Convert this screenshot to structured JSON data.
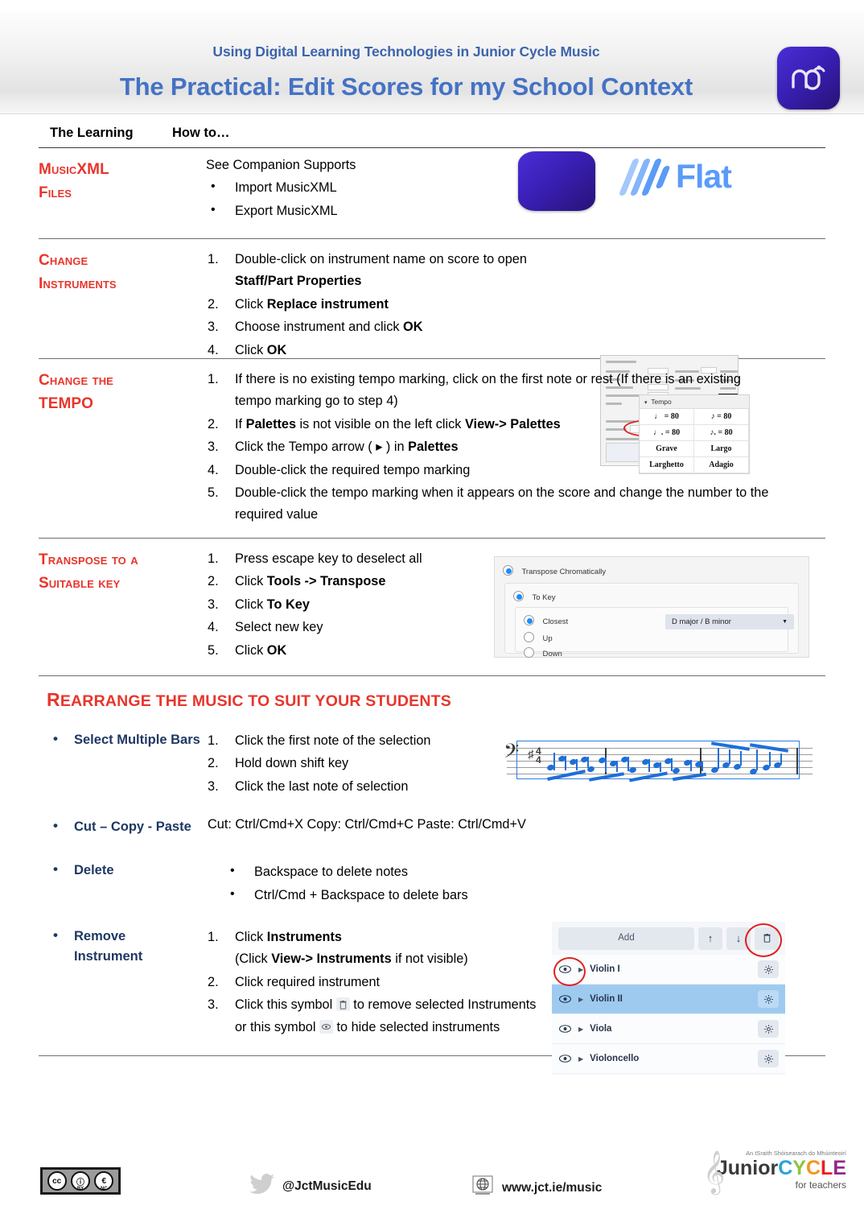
{
  "header": {
    "subtitle": "Using Digital Learning Technologies in Junior Cycle Music",
    "title": "The Practical: Edit Scores for my School Context",
    "logo_icon": "musescore-logo-icon",
    "title_color": "#4472C4",
    "subtitle_color": "#3C64AD"
  },
  "table": {
    "col1_header": "The Learning",
    "col2_header": "How to…",
    "rows": [
      {
        "learning": "MusicXML Files",
        "intro": "See Companion Supports",
        "bullets": [
          "Import MusicXML",
          "Export MusicXML"
        ],
        "figure": "musescore-and-flat-logos",
        "flat_label": "Flat"
      },
      {
        "learning": "Change Instruments",
        "steps": [
          {
            "pre": "Double-click on instrument name on score to open ",
            "bold": "Staff/Part Properties",
            "post": ""
          },
          {
            "pre": "Click ",
            "bold": "Replace instrument",
            "post": ""
          },
          {
            "pre": "Choose instrument and click ",
            "bold": "OK",
            "post": ""
          },
          {
            "pre": "Click ",
            "bold": "OK",
            "post": ""
          }
        ],
        "figure": "staff-part-properties-dialog-screenshot"
      },
      {
        "learning": "Change the Tempo",
        "steps": [
          {
            "pre": "If there is no existing tempo marking, click on the first note or rest (If there is an existing tempo marking go to step 4)",
            "bold": "",
            "post": ""
          },
          {
            "pre": "If ",
            "bold": "Palettes",
            "post": " is not visible on the left click ",
            "bold2": "View-> Palettes"
          },
          {
            "pre": "Click the Tempo arrow ( ▸ ) in ",
            "bold": "Palettes",
            "post": ""
          },
          {
            "pre": "Double-click the required tempo marking",
            "bold": "",
            "post": ""
          },
          {
            "pre": "Double-click the tempo marking when it appears on the score and change the number to the required value",
            "bold": "",
            "post": ""
          }
        ],
        "figure": "tempo-palette-screenshot",
        "palette": {
          "title": "Tempo",
          "cells": [
            "♩ = 80",
            "♪ = 80",
            "♩. = 80",
            "♪. = 80",
            "Grave",
            "Largo",
            "Larghetto",
            "Adagio"
          ]
        }
      },
      {
        "learning": "Transpose to a suitable key",
        "steps": [
          {
            "pre": "Press escape key to deselect all",
            "bold": "",
            "post": ""
          },
          {
            "pre": "Click ",
            "bold": "Tools -> Transpose",
            "post": ""
          },
          {
            "pre": "Click ",
            "bold": "To Key",
            "post": ""
          },
          {
            "pre": "Select new key",
            "bold": "",
            "post": ""
          },
          {
            "pre": "Click ",
            "bold": "OK",
            "post": ""
          }
        ],
        "figure": "transpose-dialog-screenshot",
        "dialog": {
          "opt_chromatic": "Transpose Chromatically",
          "opt_tokey": "To Key",
          "opt_closest": "Closest",
          "opt_up": "Up",
          "opt_down": "Down",
          "key_value": "D major / B minor"
        }
      }
    ]
  },
  "rearrange": {
    "heading": "Rearrange the music to suit your students",
    "items": [
      {
        "label": "Select Multiple Bars",
        "steps": [
          "Click the first note of the selection",
          "Hold down shift key",
          "Click the last note of selection"
        ],
        "figure": "music-staff-selection-screenshot"
      },
      {
        "label": "Cut – Copy - Paste",
        "text": "Cut: Ctrl/Cmd+X   Copy: Ctrl/Cmd+C  Paste: Ctrl/Cmd+V"
      },
      {
        "label": "Delete",
        "bullets": [
          "Backspace to delete notes",
          "Ctrl/Cmd + Backspace to delete bars"
        ]
      },
      {
        "label": "Remove Instrument",
        "steps_rich": [
          {
            "a": "Click ",
            "b": "Instruments",
            "c": "",
            "line2_a": "(Click ",
            "line2_b": "View-> Instruments",
            "line2_c": " if not visible)"
          },
          {
            "a": "Click required instrument",
            "b": "",
            "c": ""
          },
          {
            "a": "Click this symbol ",
            "b": "",
            "c": " to remove selected Instruments or this symbol ",
            "d": " to hide selected instruments",
            "icon1": "trash-icon",
            "icon2": "eye-icon"
          }
        ],
        "figure": "instruments-panel-screenshot",
        "panel": {
          "add_label": "Add",
          "up_icon": "arrow-up-icon",
          "down_icon": "arrow-down-icon",
          "trash_icon": "trash-icon",
          "instruments": [
            {
              "name": "Violin I",
              "selected": false,
              "highlight_eye": true
            },
            {
              "name": "Violin II",
              "selected": true,
              "highlight_eye": false
            },
            {
              "name": "Viola",
              "selected": false,
              "highlight_eye": false
            },
            {
              "name": "Violoncello",
              "selected": false,
              "highlight_eye": false
            }
          ]
        }
      }
    ]
  },
  "footer": {
    "cc_badge": {
      "cc": "cc",
      "by": "BY",
      "nc": "NC"
    },
    "twitter_handle": "@JctMusicEdu",
    "website": "www.jct.ie/music",
    "jc_logo": {
      "tagline": "An tSraith Shóisearach do Mhúinteoirí",
      "word1": "Junior",
      "word2": "CYCLE",
      "sub": "for teachers"
    }
  },
  "colors": {
    "red": "#E8352B",
    "navy": "#1F3864",
    "title_blue": "#4472C4",
    "flat_blue": "#5B9BF8",
    "musescore_purple": "#3A1FB5",
    "selection_blue": "#9FCAF0"
  }
}
